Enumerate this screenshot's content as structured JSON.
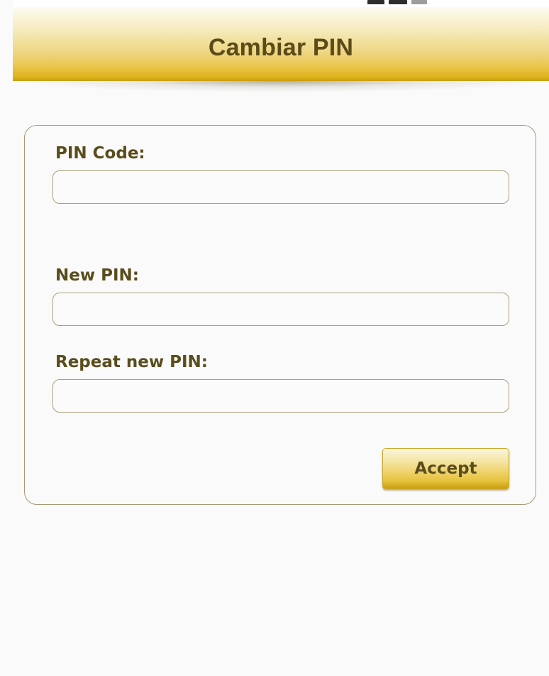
{
  "header": {
    "title": "Cambiar PIN"
  },
  "status_bar": {
    "icons": [
      "signal-icon",
      "battery-icon",
      "indicator-icon"
    ]
  },
  "form": {
    "pin_code": {
      "label": "PIN Code:",
      "value": "",
      "placeholder": ""
    },
    "new_pin": {
      "label": "New PIN:",
      "value": "",
      "placeholder": ""
    },
    "repeat_new_pin": {
      "label": "Repeat new PIN:",
      "value": "",
      "placeholder": ""
    },
    "accept_label": "Accept"
  },
  "colors": {
    "accent_gold": "#e9c546",
    "text_brown": "#5a4d1d",
    "border": "#a59a75",
    "background": "#fafafa"
  }
}
